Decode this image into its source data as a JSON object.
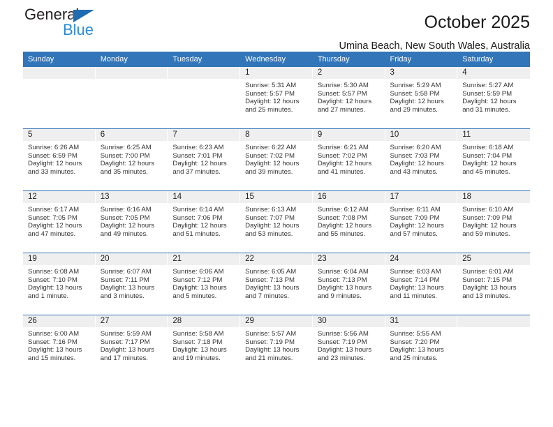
{
  "brand": {
    "name_part1": "General",
    "name_part2": "Blue",
    "accent_color": "#2b8ad6",
    "triangle_color": "#1f6cb0"
  },
  "header": {
    "title": "October 2025",
    "location": "Umina Beach, New South Wales, Australia"
  },
  "calendar": {
    "header_bg": "#3275b9",
    "date_band_bg": "#efefef",
    "weekday_headers": [
      "Sunday",
      "Monday",
      "Tuesday",
      "Wednesday",
      "Thursday",
      "Friday",
      "Saturday"
    ],
    "weeks": [
      [
        {
          "date": "",
          "lines": []
        },
        {
          "date": "",
          "lines": []
        },
        {
          "date": "",
          "lines": []
        },
        {
          "date": "1",
          "lines": [
            "Sunrise: 5:31 AM",
            "Sunset: 5:57 PM",
            "Daylight: 12 hours",
            "and 25 minutes."
          ]
        },
        {
          "date": "2",
          "lines": [
            "Sunrise: 5:30 AM",
            "Sunset: 5:57 PM",
            "Daylight: 12 hours",
            "and 27 minutes."
          ]
        },
        {
          "date": "3",
          "lines": [
            "Sunrise: 5:29 AM",
            "Sunset: 5:58 PM",
            "Daylight: 12 hours",
            "and 29 minutes."
          ]
        },
        {
          "date": "4",
          "lines": [
            "Sunrise: 5:27 AM",
            "Sunset: 5:59 PM",
            "Daylight: 12 hours",
            "and 31 minutes."
          ]
        }
      ],
      [
        {
          "date": "5",
          "lines": [
            "Sunrise: 6:26 AM",
            "Sunset: 6:59 PM",
            "Daylight: 12 hours",
            "and 33 minutes."
          ]
        },
        {
          "date": "6",
          "lines": [
            "Sunrise: 6:25 AM",
            "Sunset: 7:00 PM",
            "Daylight: 12 hours",
            "and 35 minutes."
          ]
        },
        {
          "date": "7",
          "lines": [
            "Sunrise: 6:23 AM",
            "Sunset: 7:01 PM",
            "Daylight: 12 hours",
            "and 37 minutes."
          ]
        },
        {
          "date": "8",
          "lines": [
            "Sunrise: 6:22 AM",
            "Sunset: 7:02 PM",
            "Daylight: 12 hours",
            "and 39 minutes."
          ]
        },
        {
          "date": "9",
          "lines": [
            "Sunrise: 6:21 AM",
            "Sunset: 7:02 PM",
            "Daylight: 12 hours",
            "and 41 minutes."
          ]
        },
        {
          "date": "10",
          "lines": [
            "Sunrise: 6:20 AM",
            "Sunset: 7:03 PM",
            "Daylight: 12 hours",
            "and 43 minutes."
          ]
        },
        {
          "date": "11",
          "lines": [
            "Sunrise: 6:18 AM",
            "Sunset: 7:04 PM",
            "Daylight: 12 hours",
            "and 45 minutes."
          ]
        }
      ],
      [
        {
          "date": "12",
          "lines": [
            "Sunrise: 6:17 AM",
            "Sunset: 7:05 PM",
            "Daylight: 12 hours",
            "and 47 minutes."
          ]
        },
        {
          "date": "13",
          "lines": [
            "Sunrise: 6:16 AM",
            "Sunset: 7:05 PM",
            "Daylight: 12 hours",
            "and 49 minutes."
          ]
        },
        {
          "date": "14",
          "lines": [
            "Sunrise: 6:14 AM",
            "Sunset: 7:06 PM",
            "Daylight: 12 hours",
            "and 51 minutes."
          ]
        },
        {
          "date": "15",
          "lines": [
            "Sunrise: 6:13 AM",
            "Sunset: 7:07 PM",
            "Daylight: 12 hours",
            "and 53 minutes."
          ]
        },
        {
          "date": "16",
          "lines": [
            "Sunrise: 6:12 AM",
            "Sunset: 7:08 PM",
            "Daylight: 12 hours",
            "and 55 minutes."
          ]
        },
        {
          "date": "17",
          "lines": [
            "Sunrise: 6:11 AM",
            "Sunset: 7:09 PM",
            "Daylight: 12 hours",
            "and 57 minutes."
          ]
        },
        {
          "date": "18",
          "lines": [
            "Sunrise: 6:10 AM",
            "Sunset: 7:09 PM",
            "Daylight: 12 hours",
            "and 59 minutes."
          ]
        }
      ],
      [
        {
          "date": "19",
          "lines": [
            "Sunrise: 6:08 AM",
            "Sunset: 7:10 PM",
            "Daylight: 13 hours",
            "and 1 minute."
          ]
        },
        {
          "date": "20",
          "lines": [
            "Sunrise: 6:07 AM",
            "Sunset: 7:11 PM",
            "Daylight: 13 hours",
            "and 3 minutes."
          ]
        },
        {
          "date": "21",
          "lines": [
            "Sunrise: 6:06 AM",
            "Sunset: 7:12 PM",
            "Daylight: 13 hours",
            "and 5 minutes."
          ]
        },
        {
          "date": "22",
          "lines": [
            "Sunrise: 6:05 AM",
            "Sunset: 7:13 PM",
            "Daylight: 13 hours",
            "and 7 minutes."
          ]
        },
        {
          "date": "23",
          "lines": [
            "Sunrise: 6:04 AM",
            "Sunset: 7:13 PM",
            "Daylight: 13 hours",
            "and 9 minutes."
          ]
        },
        {
          "date": "24",
          "lines": [
            "Sunrise: 6:03 AM",
            "Sunset: 7:14 PM",
            "Daylight: 13 hours",
            "and 11 minutes."
          ]
        },
        {
          "date": "25",
          "lines": [
            "Sunrise: 6:01 AM",
            "Sunset: 7:15 PM",
            "Daylight: 13 hours",
            "and 13 minutes."
          ]
        }
      ],
      [
        {
          "date": "26",
          "lines": [
            "Sunrise: 6:00 AM",
            "Sunset: 7:16 PM",
            "Daylight: 13 hours",
            "and 15 minutes."
          ]
        },
        {
          "date": "27",
          "lines": [
            "Sunrise: 5:59 AM",
            "Sunset: 7:17 PM",
            "Daylight: 13 hours",
            "and 17 minutes."
          ]
        },
        {
          "date": "28",
          "lines": [
            "Sunrise: 5:58 AM",
            "Sunset: 7:18 PM",
            "Daylight: 13 hours",
            "and 19 minutes."
          ]
        },
        {
          "date": "29",
          "lines": [
            "Sunrise: 5:57 AM",
            "Sunset: 7:19 PM",
            "Daylight: 13 hours",
            "and 21 minutes."
          ]
        },
        {
          "date": "30",
          "lines": [
            "Sunrise: 5:56 AM",
            "Sunset: 7:19 PM",
            "Daylight: 13 hours",
            "and 23 minutes."
          ]
        },
        {
          "date": "31",
          "lines": [
            "Sunrise: 5:55 AM",
            "Sunset: 7:20 PM",
            "Daylight: 13 hours",
            "and 25 minutes."
          ]
        },
        {
          "date": "",
          "lines": []
        }
      ]
    ]
  }
}
